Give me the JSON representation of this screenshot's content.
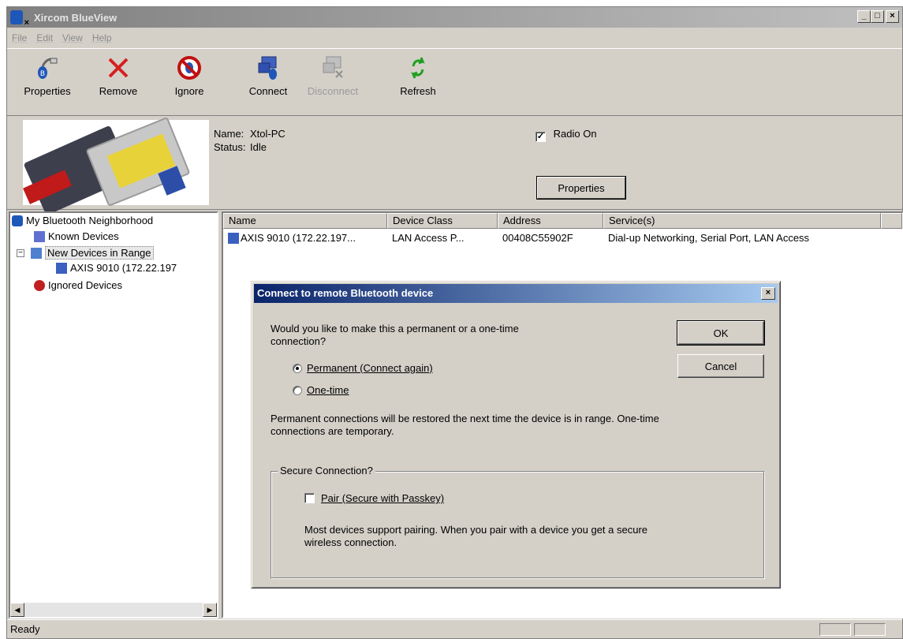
{
  "window": {
    "title": "Xircom BlueView",
    "buttons": [
      "_",
      "□",
      "×"
    ]
  },
  "menu": [
    "File",
    "Edit",
    "View",
    "Help"
  ],
  "toolbar": [
    {
      "label": "Properties",
      "icon": "properties-icon",
      "enabled": true
    },
    {
      "label": "Remove",
      "icon": "remove-icon",
      "enabled": true
    },
    {
      "label": "Ignore",
      "icon": "ignore-icon",
      "enabled": true
    },
    {
      "label": "Connect",
      "icon": "connect-icon",
      "enabled": true
    },
    {
      "label": "Disconnect",
      "icon": "disconnect-icon",
      "enabled": false
    },
    {
      "label": "Refresh",
      "icon": "refresh-icon",
      "enabled": true
    }
  ],
  "device_info": {
    "name_label": "Name:",
    "name_value": "Xtol-PC",
    "status_label": "Status:",
    "status_value": "Idle",
    "radio_label": "Radio On",
    "radio_checked": true,
    "properties_button": "Properties"
  },
  "tree": {
    "root": "My Bluetooth Neighborhood",
    "known": "Known Devices",
    "new_in_range": "New Devices in Range",
    "device": "AXIS 9010 (172.22.197",
    "ignored": "Ignored Devices"
  },
  "list": {
    "columns": [
      "Name",
      "Device Class",
      "Address",
      "Service(s)"
    ],
    "rows": [
      {
        "name": "AXIS 9010 (172.22.197...",
        "class": "LAN Access P...",
        "address": "00408C55902F",
        "services": "Dial-up Networking, Serial Port, LAN Access"
      }
    ]
  },
  "status": {
    "text": "Ready"
  },
  "dialog": {
    "title": "Connect to remote Bluetooth device",
    "question_line1": "Would you like to make this a permanent or a one-time",
    "question_line2": "connection?",
    "option_permanent": "Permanent (Connect again)",
    "option_onetime": "One-time",
    "selected": "permanent",
    "note_line1": "Permanent connections will be restored the next time the device is in range. One-time",
    "note_line2": "connections are temporary.",
    "group_label": "Secure Connection?",
    "pair_label": "Pair (Secure with Passkey)",
    "pair_checked": false,
    "pair_note_line1": "Most devices support pairing. When you pair with a device you get a secure",
    "pair_note_line2": "wireless connection.",
    "ok": "OK",
    "cancel": "Cancel"
  },
  "colors": {
    "dialog_title_start": "#0a246a",
    "dialog_title_end": "#a6caf0",
    "face": "#d4d0c8"
  }
}
